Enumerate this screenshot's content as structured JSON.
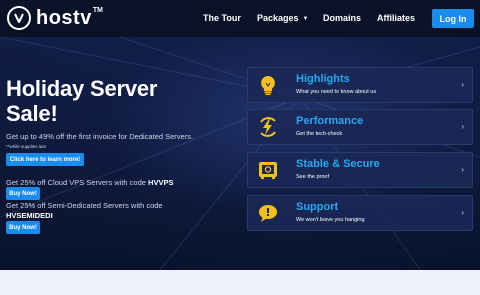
{
  "brand": {
    "name": "hostv",
    "trademark": "TM"
  },
  "nav": {
    "links": [
      "The Tour",
      "Packages",
      "Domains",
      "Affiliates"
    ],
    "login_label": "Log In"
  },
  "hero": {
    "headline_line1": "Holiday Server",
    "headline_line2": "Sale!",
    "promo1_text": "Get up to 49% off the first invoice for Dedicated Servers.",
    "promo1_note": "**while supplies last",
    "learn_more_label": "Click here to learn more!",
    "promo2_text": "Get 25% off Cloud VPS Servers with code ",
    "promo2_code": "HVVPS",
    "buy_now_label": "Buy Now!",
    "promo3_text": "Get 25% off Semi-Dedicated Servers with code ",
    "promo3_code": "HVSEMIDEDI"
  },
  "features": [
    {
      "title": "Highlights",
      "subtitle": "What you need to know about us",
      "icon": "lightbulb-icon"
    },
    {
      "title": "Performance",
      "subtitle": "Get the tech-check",
      "icon": "lightning-bolt-icon"
    },
    {
      "title": "Stable & Secure",
      "subtitle": "See the proof",
      "icon": "safe-icon"
    },
    {
      "title": "Support",
      "subtitle": "We won't leave you hanging",
      "icon": "chat-bubble-icon"
    }
  ],
  "colors": {
    "accent": "#1a8cf0",
    "feature_title": "#25aaf2",
    "icon_yellow": "#f5c01a",
    "background": "#0b1633"
  }
}
